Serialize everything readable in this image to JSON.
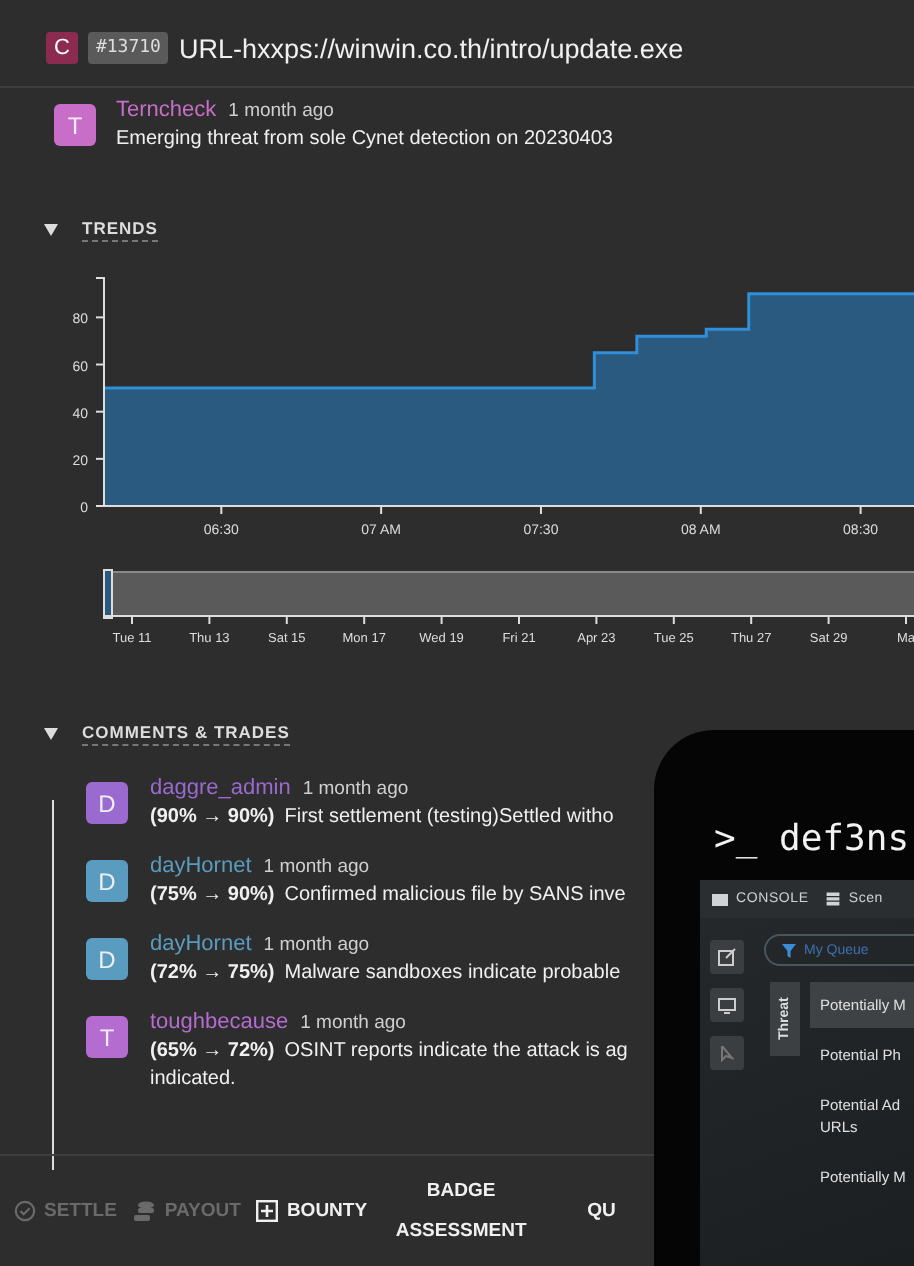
{
  "header": {
    "kind_badge": "C",
    "id_badge": "#13710",
    "title": "URL-hxxps://winwin.co.th/intro/update.exe"
  },
  "description": {
    "avatar": "T",
    "author": "Terncheck",
    "color": "#c86ec8",
    "time": "1 month ago",
    "text": "Emerging threat from sole Cynet detection on 20230403"
  },
  "trends": {
    "heading": "TRENDS",
    "expanded": true,
    "chart_data": {
      "type": "area",
      "x": [
        6.133,
        7.667,
        7.667,
        7.8,
        7.8,
        8.017,
        8.017,
        8.15,
        8.15,
        8.667
      ],
      "series": [
        {
          "color": "#2a5a80",
          "values": [
            50,
            50,
            65,
            65,
            72,
            72,
            75,
            75,
            90,
            90
          ]
        }
      ],
      "xlim": [
        6.133,
        8.667
      ],
      "ylim": [
        0,
        95
      ],
      "xticks": [
        {
          "value": 6.5,
          "label": "06:30"
        },
        {
          "value": 7,
          "label": "07 AM"
        },
        {
          "value": 7.5,
          "label": "07:30"
        },
        {
          "value": 8,
          "label": "08 AM"
        },
        {
          "value": 8.5,
          "label": "08:30"
        }
      ],
      "yticks": [
        0,
        20,
        40,
        60,
        80
      ]
    },
    "brush_ticks": [
      "Tue 11",
      "Thu 13",
      "Sat 15",
      "Mon 17",
      "Wed 19",
      "Fri 21",
      "Apr 23",
      "Tue 25",
      "Thu 27",
      "Sat 29",
      "Ma"
    ]
  },
  "comments": {
    "heading": "COMMENTS & TRADES",
    "expanded": true,
    "items": [
      {
        "avatar": "D",
        "author": "daggre_admin",
        "color": "#9a6ad0",
        "time": "1 month ago",
        "change": "(90% → 90%)",
        "text": "First settlement (testing)Settled witho"
      },
      {
        "avatar": "D",
        "author": "dayHornet",
        "color": "#5a9cc0",
        "time": "1 month ago",
        "change": "(75% → 90%)",
        "text": "Confirmed malicious file by SANS inve"
      },
      {
        "avatar": "D",
        "author": "dayHornet",
        "color": "#5a9cc0",
        "time": "1 month ago",
        "change": "(72% → 75%)",
        "text": "Malware sandboxes indicate probable"
      },
      {
        "avatar": "T",
        "author": "toughbecause",
        "color": "#b46cd0",
        "time": "1 month ago",
        "change": "(65% → 72%)",
        "text": "OSINT reports indicate the attack is ag",
        "text_2": "indicated."
      }
    ]
  },
  "actions": [
    {
      "kind": "settle",
      "label": "SETTLE",
      "disabled": true
    },
    {
      "kind": "payout",
      "label": "PAYOUT",
      "disabled": true
    },
    {
      "kind": "bounty",
      "label": "BOUNTY",
      "disabled": false
    },
    {
      "kind": "stacked",
      "label": "BADGE ASSESSMENT",
      "disabled": false
    },
    {
      "kind": "text",
      "label": "QU",
      "disabled": false
    }
  ],
  "device_mockup": {
    "logo": ">_ def3ns",
    "toolbar": [
      "CONSOLE",
      "Scen"
    ],
    "filter_placeholder": "My Queue",
    "vertical_tab": "Threat",
    "items": [
      {
        "label": "Potentially M",
        "selected": true
      },
      {
        "label": "Potential Ph",
        "selected": false
      },
      {
        "label": "Potential Ad URLs",
        "selected": false
      },
      {
        "label": "Potentially M",
        "selected": false
      }
    ]
  }
}
